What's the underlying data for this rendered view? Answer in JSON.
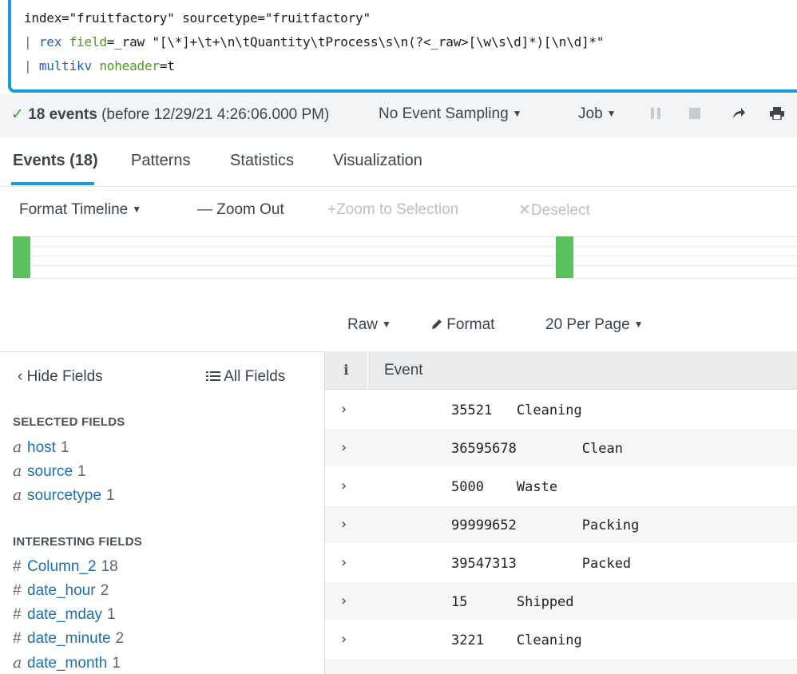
{
  "search": {
    "line1": "index=\"fruitfactory\" sourcetype=\"fruitfactory\"",
    "line2_pipe": "| ",
    "line2_cmd": "rex",
    "line2_arg": "field",
    "line2_rest": "=_raw \"[\\*]+\\t+\\n\\tQuantity\\tProcess\\s\\n(?<_raw>[\\w\\s\\d]*)[\\n\\d]*\"",
    "line3_pipe": "| ",
    "line3_cmd": "multikv",
    "line3_arg": "noheader",
    "line3_rest": "=t"
  },
  "status": {
    "check": "✓",
    "count": "18 events",
    "before": "(before 12/29/21 4:26:06.000 PM)",
    "sampling": "No Event Sampling",
    "job": "Job"
  },
  "tabs": [
    {
      "label": "Events (18)"
    },
    {
      "label": "Patterns"
    },
    {
      "label": "Statistics"
    },
    {
      "label": "Visualization"
    }
  ],
  "timeline_toolbar": {
    "format": "Format Timeline",
    "zoom_out": "Zoom Out",
    "zoom_selection": "Zoom to Selection",
    "deselect": "Deselect"
  },
  "results_toolbar": {
    "raw": "Raw",
    "format": "Format",
    "per_page": "20 Per Page"
  },
  "sidebar": {
    "hide_fields": "Hide Fields",
    "all_fields": "All Fields",
    "selected_title": "SELECTED FIELDS",
    "selected": [
      {
        "type": "a",
        "name": "host",
        "count": "1"
      },
      {
        "type": "a",
        "name": "source",
        "count": "1"
      },
      {
        "type": "a",
        "name": "sourcetype",
        "count": "1"
      }
    ],
    "interesting_title": "INTERESTING FIELDS",
    "interesting": [
      {
        "type": "#",
        "name": "Column_2",
        "count": "18"
      },
      {
        "type": "#",
        "name": "date_hour",
        "count": "2"
      },
      {
        "type": "#",
        "name": "date_mday",
        "count": "1"
      },
      {
        "type": "#",
        "name": "date_minute",
        "count": "2"
      },
      {
        "type": "a",
        "name": "date_month",
        "count": "1"
      }
    ]
  },
  "events": {
    "info_header": "i",
    "event_header": "Event",
    "rows": [
      "35521   Cleaning",
      "36595678        Clean",
      "5000    Waste",
      "99999652        Packing",
      "39547313        Packed",
      "15      Shipped",
      "3221    Cleaning"
    ]
  },
  "colors": {
    "accent": "#1a9cd8",
    "timeline_bar": "#5cc060",
    "field_link": "#1e6fb0"
  }
}
